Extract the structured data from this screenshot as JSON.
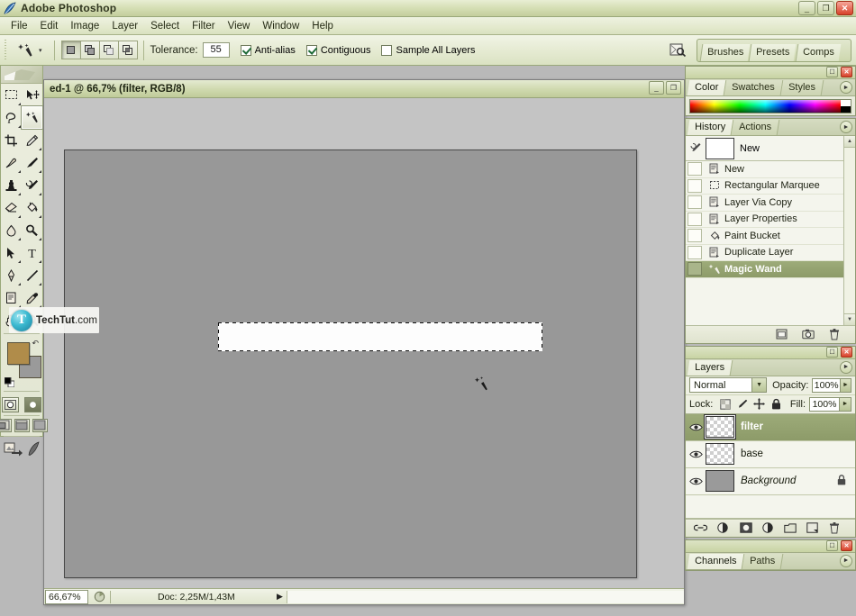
{
  "app": {
    "title": "Adobe Photoshop",
    "logo_icon": "photoshop-feather-icon",
    "window_buttons": [
      {
        "name": "minimize",
        "glyph": "_"
      },
      {
        "name": "restore",
        "glyph": "❐"
      },
      {
        "name": "close",
        "glyph": "✕"
      }
    ]
  },
  "menubar": {
    "items": [
      "File",
      "Edit",
      "Image",
      "Layer",
      "Select",
      "Filter",
      "View",
      "Window",
      "Help"
    ]
  },
  "options_bar": {
    "tool_icon": "magic-wand-icon",
    "tool_preset_caret": "▾",
    "selection_modes": [
      {
        "name": "new-selection",
        "active": true
      },
      {
        "name": "add-to-selection",
        "active": false
      },
      {
        "name": "subtract-from-selection",
        "active": false
      },
      {
        "name": "intersect-with-selection",
        "active": false
      }
    ],
    "tolerance_label": "Tolerance:",
    "tolerance_value": "55",
    "checkboxes": [
      {
        "label": "Anti-alias",
        "checked": true
      },
      {
        "label": "Contiguous",
        "checked": true
      },
      {
        "label": "Sample All Layers",
        "checked": false
      }
    ],
    "file_browser_icon": "file-browser-icon",
    "palette_well_tabs": [
      "Brushes",
      "Presets",
      "Comps"
    ]
  },
  "toolbox": {
    "tools": [
      {
        "row": 0,
        "col": 0,
        "name": "rectangular-marquee-tool",
        "has_menu": true,
        "selected": false
      },
      {
        "row": 0,
        "col": 1,
        "name": "move-tool",
        "has_menu": false,
        "selected": false
      },
      {
        "row": 1,
        "col": 0,
        "name": "lasso-tool",
        "has_menu": true,
        "selected": false
      },
      {
        "row": 1,
        "col": 1,
        "name": "magic-wand-tool",
        "has_menu": false,
        "selected": true
      },
      {
        "row": 2,
        "col": 0,
        "name": "crop-tool",
        "has_menu": false,
        "selected": false
      },
      {
        "row": 2,
        "col": 1,
        "name": "slice-tool",
        "has_menu": true,
        "selected": false
      },
      {
        "row": 3,
        "col": 0,
        "name": "healing-brush-tool",
        "has_menu": true,
        "selected": false
      },
      {
        "row": 3,
        "col": 1,
        "name": "brush-tool",
        "has_menu": true,
        "selected": false
      },
      {
        "row": 4,
        "col": 0,
        "name": "clone-stamp-tool",
        "has_menu": true,
        "selected": false
      },
      {
        "row": 4,
        "col": 1,
        "name": "history-brush-tool",
        "has_menu": true,
        "selected": false
      },
      {
        "row": 5,
        "col": 0,
        "name": "eraser-tool",
        "has_menu": true,
        "selected": false
      },
      {
        "row": 5,
        "col": 1,
        "name": "paint-bucket-tool",
        "has_menu": true,
        "selected": false
      },
      {
        "row": 6,
        "col": 0,
        "name": "blur-tool",
        "has_menu": true,
        "selected": false
      },
      {
        "row": 6,
        "col": 1,
        "name": "dodge-tool",
        "has_menu": true,
        "selected": false
      },
      {
        "row": 7,
        "col": 0,
        "name": "path-selection-tool",
        "has_menu": true,
        "selected": false
      },
      {
        "row": 7,
        "col": 1,
        "name": "type-tool",
        "has_menu": true,
        "selected": false
      },
      {
        "row": 8,
        "col": 0,
        "name": "pen-tool",
        "has_menu": true,
        "selected": false
      },
      {
        "row": 8,
        "col": 1,
        "name": "line-shape-tool",
        "has_menu": true,
        "selected": false
      },
      {
        "row": 9,
        "col": 0,
        "name": "notes-tool",
        "has_menu": true,
        "selected": false
      },
      {
        "row": 9,
        "col": 1,
        "name": "eyedropper-tool",
        "has_menu": true,
        "selected": false
      },
      {
        "row": 10,
        "col": 0,
        "name": "hand-tool",
        "has_menu": false,
        "selected": false
      },
      {
        "row": 10,
        "col": 1,
        "name": "zoom-tool",
        "has_menu": false,
        "selected": false
      }
    ],
    "foreground_color": "#b08c4a",
    "background_color": "#9a9a9a",
    "default_colors_icon": "default-colors-icon",
    "swap_colors_icon": "swap-colors-icon",
    "mask_modes": [
      {
        "name": "standard-mode",
        "active": true
      },
      {
        "name": "quick-mask-mode",
        "active": false
      }
    ],
    "screen_modes": [
      {
        "name": "standard-screen-mode",
        "active": true
      },
      {
        "name": "full-screen-with-menubar-mode",
        "active": false
      },
      {
        "name": "full-screen-mode",
        "active": false
      }
    ],
    "jump_to_imageready_icon": "jump-to-imageready-icon"
  },
  "watermark": {
    "logo_glyph": "T",
    "brand": "TechTut",
    "tld": ".com"
  },
  "document": {
    "title": "ed-1 @ 66,7% (filter, RGB/8)",
    "window_buttons": [
      {
        "name": "minimize",
        "glyph": "_"
      },
      {
        "name": "maximize",
        "glyph": "❐"
      },
      {
        "name": "close",
        "glyph": "✕"
      }
    ],
    "canvas": {
      "background_color": "#989898",
      "selection": {
        "name": "rectangular-marquee-selection",
        "fill_color": "#fdfdfd"
      },
      "cursor_icon": "magic-wand-cursor"
    },
    "status_bar": {
      "zoom_value": "66,67%",
      "preview_icon": "preview-thumb-icon",
      "doc_info": "Doc: 2,25M/1,43M",
      "expand_arrow": "▶"
    }
  },
  "palettes": {
    "color": {
      "tabs": [
        {
          "label": "Color",
          "active": true
        },
        {
          "label": "Swatches",
          "active": false
        },
        {
          "label": "Styles",
          "active": false
        }
      ],
      "menu_icon": "palette-menu-icon",
      "ramp_name": "color-spectrum-ramp"
    },
    "history": {
      "tabs": [
        {
          "label": "History",
          "active": true
        },
        {
          "label": "Actions",
          "active": false
        }
      ],
      "menu_icon": "palette-menu-icon",
      "snapshot": {
        "label": "New",
        "icon": "history-brush-source-icon"
      },
      "states": [
        {
          "label": "New",
          "icon": "document-state-icon",
          "selected": false
        },
        {
          "label": "Rectangular Marquee",
          "icon": "marquee-state-icon",
          "selected": false
        },
        {
          "label": "Layer Via Copy",
          "icon": "document-state-icon",
          "selected": false
        },
        {
          "label": "Layer Properties",
          "icon": "document-state-icon",
          "selected": false
        },
        {
          "label": "Paint Bucket",
          "icon": "paint-bucket-state-icon",
          "selected": false
        },
        {
          "label": "Duplicate Layer",
          "icon": "document-state-icon",
          "selected": false
        },
        {
          "label": "Magic Wand",
          "icon": "magic-wand-state-icon",
          "selected": true
        }
      ],
      "footer_icons": [
        {
          "name": "create-document-from-state-icon"
        },
        {
          "name": "create-new-snapshot-icon"
        },
        {
          "name": "delete-state-icon"
        }
      ]
    },
    "layers": {
      "tabs": [
        {
          "label": "Layers",
          "active": true
        }
      ],
      "menu_icon": "palette-menu-icon",
      "blend_mode": "Normal",
      "opacity_label": "Opacity:",
      "opacity_value": "100%",
      "lock_label": "Lock:",
      "lock_icons": [
        {
          "name": "lock-transparent-pixels-icon"
        },
        {
          "name": "lock-image-pixels-icon"
        },
        {
          "name": "lock-position-icon"
        },
        {
          "name": "lock-all-icon"
        }
      ],
      "fill_label": "Fill:",
      "fill_value": "100%",
      "items": [
        {
          "name": "filter",
          "visible": true,
          "selected": true,
          "thumb": "transparent",
          "locked": false,
          "italic": false
        },
        {
          "name": "base",
          "visible": true,
          "selected": false,
          "thumb": "transparent",
          "locked": false,
          "italic": false
        },
        {
          "name": "Background",
          "visible": true,
          "selected": false,
          "thumb": "gray",
          "locked": true,
          "italic": true
        }
      ],
      "footer_icons": [
        {
          "name": "link-layers-icon"
        },
        {
          "name": "layer-style-icon"
        },
        {
          "name": "add-layer-mask-icon"
        },
        {
          "name": "new-fill-adjustment-layer-icon"
        },
        {
          "name": "new-group-icon"
        },
        {
          "name": "new-layer-icon"
        },
        {
          "name": "delete-layer-icon"
        }
      ]
    },
    "channels": {
      "tabs": [
        {
          "label": "Channels",
          "active": true
        },
        {
          "label": "Paths",
          "active": false
        }
      ],
      "menu_icon": "palette-menu-icon"
    }
  },
  "colors": {
    "title_green_light": "#e8eed4",
    "title_green_dark": "#c3ce9c",
    "panel_bg": "#f0f2e6",
    "selection_green": "#9dab79",
    "canvas_gray": "#989898",
    "desktop_gray": "#b9b9b9",
    "close_red": "#d8412a"
  }
}
